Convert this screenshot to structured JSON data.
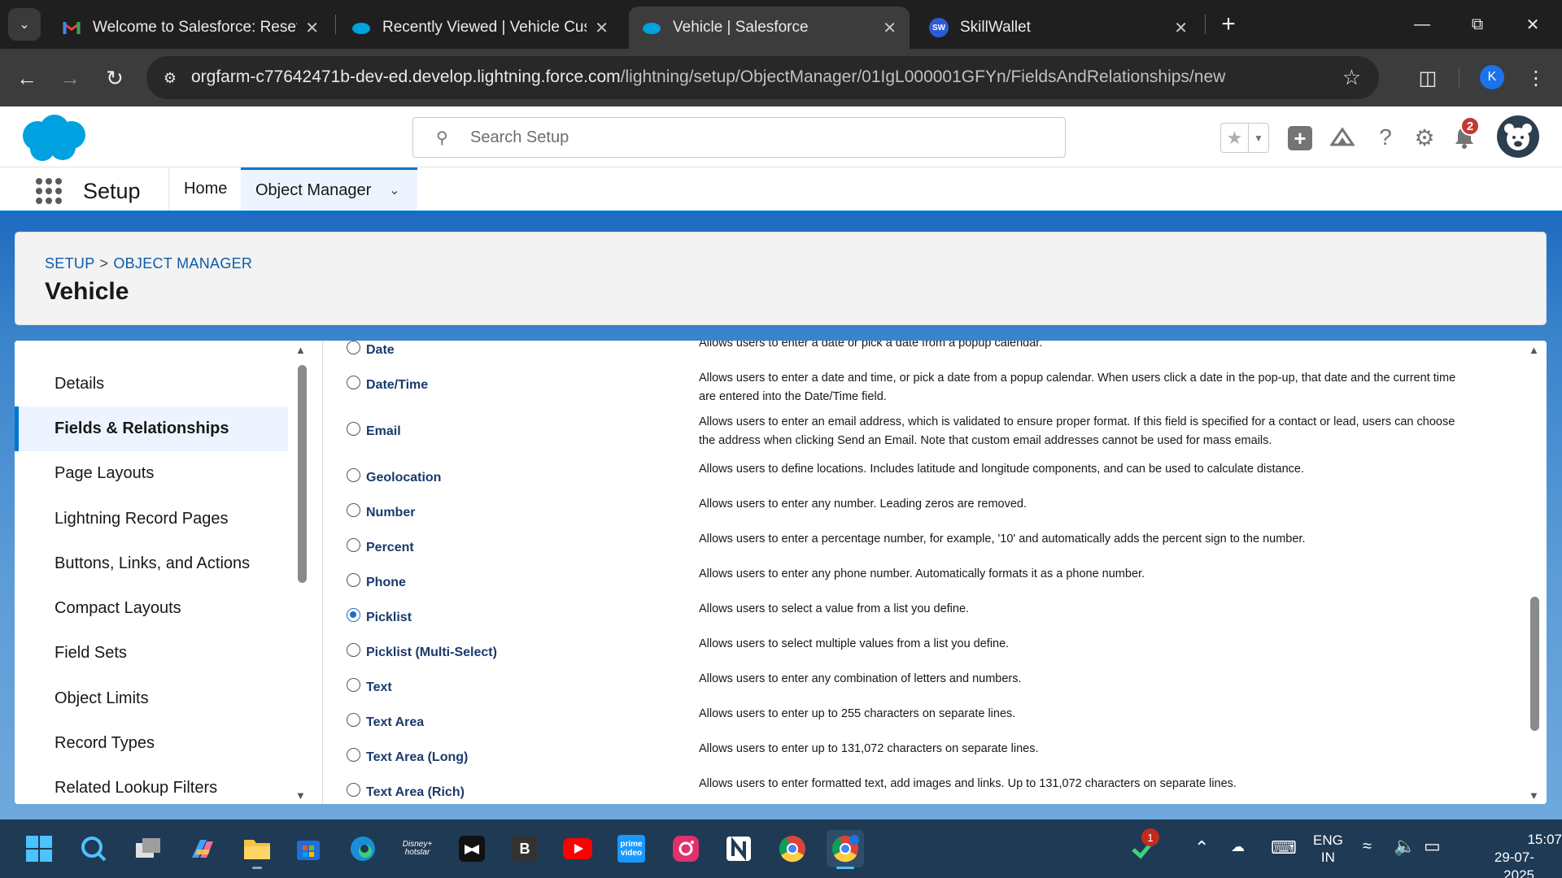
{
  "browser": {
    "tabs": [
      {
        "title": "Welcome to Salesforce: Reset y",
        "favicon": "gmail-icon",
        "active": false
      },
      {
        "title": "Recently Viewed | Vehicle Custo",
        "favicon": "salesforce-icon",
        "active": false
      },
      {
        "title": "Vehicle | Salesforce",
        "favicon": "salesforce-icon",
        "active": true
      },
      {
        "title": "SkillWallet",
        "favicon": "skillwallet-icon",
        "active": false
      }
    ],
    "skillwallet_badge": "SW",
    "url_main": "orgfarm-c77642471b-dev-ed.develop.lightning.force.com",
    "url_path": "/lightning/setup/ObjectManager/01IgL000001GFYn/FieldsAndRelationships/new",
    "profile_initial": "K"
  },
  "header": {
    "search_placeholder": "Search Setup",
    "notification_count": "2"
  },
  "setup_nav": {
    "app_name": "Setup",
    "items": [
      {
        "label": "Home",
        "active": false
      },
      {
        "label": "Object Manager",
        "active": true
      }
    ]
  },
  "page": {
    "breadcrumb": [
      "SETUP",
      "OBJECT MANAGER"
    ],
    "breadcrumb_separator": ">",
    "title": "Vehicle"
  },
  "sidebar": {
    "items": [
      {
        "label": "Details",
        "active": false
      },
      {
        "label": "Fields & Relationships",
        "active": true
      },
      {
        "label": "Page Layouts",
        "active": false
      },
      {
        "label": "Lightning Record Pages",
        "active": false
      },
      {
        "label": "Buttons, Links, and Actions",
        "active": false
      },
      {
        "label": "Compact Layouts",
        "active": false
      },
      {
        "label": "Field Sets",
        "active": false
      },
      {
        "label": "Object Limits",
        "active": false
      },
      {
        "label": "Record Types",
        "active": false
      },
      {
        "label": "Related Lookup Filters",
        "active": false
      }
    ]
  },
  "data_types": [
    {
      "label": "Date",
      "description": "Allows users to enter a date or pick a date from a popup calendar.",
      "selected": false
    },
    {
      "label": "Date/Time",
      "description": "Allows users to enter a date and time, or pick a date from a popup calendar. When users click a date in the pop-up, that date and the current time are entered into the Date/Time field.",
      "selected": false
    },
    {
      "label": "Email",
      "description": "Allows users to enter an email address, which is validated to ensure proper format. If this field is specified for a contact or lead, users can choose the address when clicking Send an Email. Note that custom email addresses cannot be used for mass emails.",
      "selected": false
    },
    {
      "label": "Geolocation",
      "description": "Allows users to define locations. Includes latitude and longitude components, and can be used to calculate distance.",
      "selected": false
    },
    {
      "label": "Number",
      "description": "Allows users to enter any number. Leading zeros are removed.",
      "selected": false
    },
    {
      "label": "Percent",
      "description": "Allows users to enter a percentage number, for example, '10' and automatically adds the percent sign to the number.",
      "selected": false
    },
    {
      "label": "Phone",
      "description": "Allows users to enter any phone number. Automatically formats it as a phone number.",
      "selected": false
    },
    {
      "label": "Picklist",
      "description": "Allows users to select a value from a list you define.",
      "selected": true
    },
    {
      "label": "Picklist (Multi-Select)",
      "description": "Allows users to select multiple values from a list you define.",
      "selected": false
    },
    {
      "label": "Text",
      "description": "Allows users to enter any combination of letters and numbers.",
      "selected": false
    },
    {
      "label": "Text Area",
      "description": "Allows users to enter up to 255 characters on separate lines.",
      "selected": false
    },
    {
      "label": "Text Area (Long)",
      "description": "Allows users to enter up to 131,072 characters on separate lines.",
      "selected": false
    },
    {
      "label": "Text Area (Rich)",
      "description": "Allows users to enter formatted text, add images and links. Up to 131,072 characters on separate lines.",
      "selected": false
    }
  ],
  "taskbar": {
    "apps": [
      "start-icon",
      "search-icon",
      "task-view-icon",
      "copilot-icon",
      "file-explorer-icon",
      "microsoft-store-icon",
      "edge-icon",
      "disney-hotstar-icon",
      "capcut-icon",
      "b-app-icon",
      "youtube-icon",
      "prime-video-icon",
      "instagram-icon",
      "notion-icon",
      "chrome-icon",
      "chrome-profile-icon"
    ],
    "tray_badge": "1",
    "language": "ENG",
    "region": "IN",
    "time": "15:07",
    "date": "29-07-2025"
  },
  "colors": {
    "salesforce_blue": "#0176d3",
    "link_blue": "#0b5cab",
    "radio_selected": "#1b6fc6",
    "badge_red": "#c23934"
  }
}
